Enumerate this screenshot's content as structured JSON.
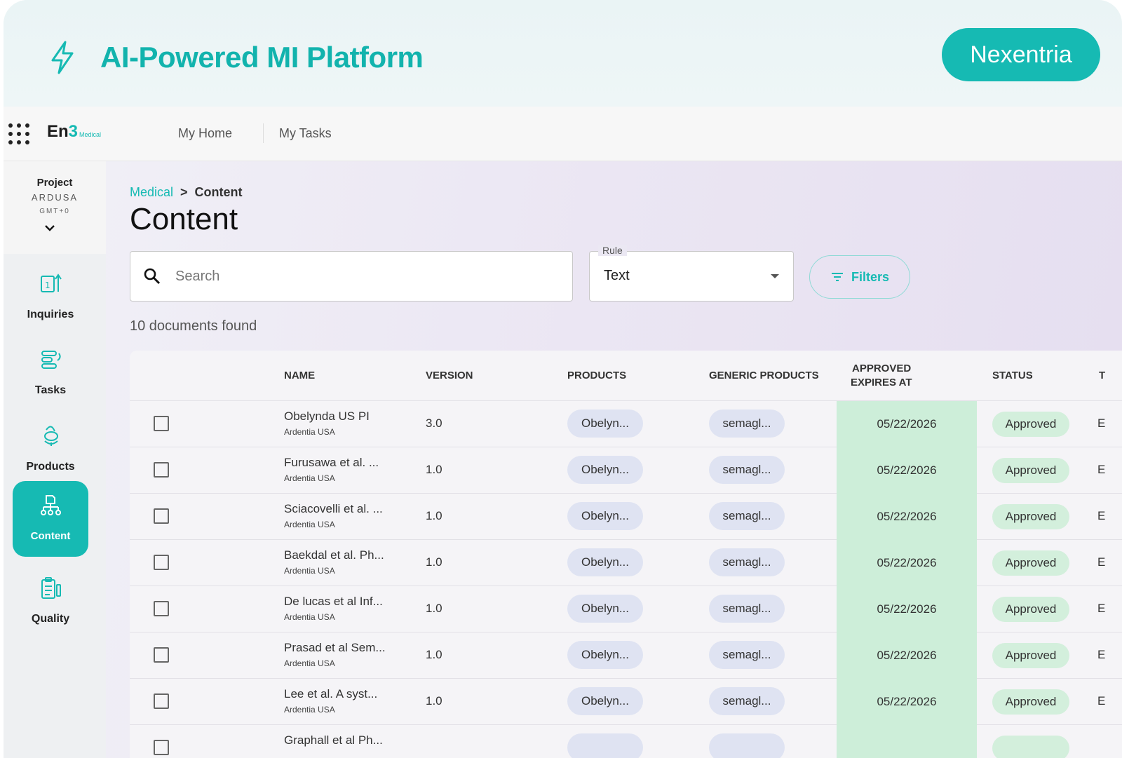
{
  "banner": {
    "title": "AI-Powered MI Platform",
    "brand_button": "Nexentria"
  },
  "topnav": {
    "logo": "En",
    "logo_three": "3",
    "logo_sub": "Medical",
    "items": [
      {
        "label": "My Home"
      },
      {
        "label": "My Tasks"
      }
    ]
  },
  "sidebar": {
    "project": {
      "label": "Project",
      "code": "ARDUSA",
      "timezone": "GMT+0"
    },
    "items": [
      {
        "label": "Inquiries",
        "icon": "inquiries-icon"
      },
      {
        "label": "Tasks",
        "icon": "tasks-icon"
      },
      {
        "label": "Products",
        "icon": "products-icon"
      },
      {
        "label": "Content",
        "icon": "content-icon",
        "active": true
      },
      {
        "label": "Quality",
        "icon": "quality-icon"
      }
    ]
  },
  "breadcrumb": {
    "root": "Medical",
    "current": "Content"
  },
  "page_title": "Content",
  "search": {
    "placeholder": "Search",
    "value": ""
  },
  "rule": {
    "label": "Rule",
    "value": "Text"
  },
  "filters_label": "Filters",
  "results_text": "10 documents found",
  "table": {
    "headers": {
      "name": "NAME",
      "version": "VERSION",
      "products": "PRODUCTS",
      "generic_products": "GENERIC PRODUCTS",
      "approved_line1": "APPROVED",
      "approved_line2": "EXPIRES AT",
      "status": "STATUS",
      "next": "T"
    },
    "rows": [
      {
        "name": "Obelynda US PI",
        "org": "Ardentia USA",
        "version": "3.0",
        "product": "Obelyn...",
        "generic": "semagl...",
        "expires": "05/22/2026",
        "status": "Approved",
        "next": "E"
      },
      {
        "name": "Furusawa et al. ...",
        "org": "Ardentia USA",
        "version": "1.0",
        "product": "Obelyn...",
        "generic": "semagl...",
        "expires": "05/22/2026",
        "status": "Approved",
        "next": "E"
      },
      {
        "name": "Sciacovelli et al. ...",
        "org": "Ardentia USA",
        "version": "1.0",
        "product": "Obelyn...",
        "generic": "semagl...",
        "expires": "05/22/2026",
        "status": "Approved",
        "next": "E"
      },
      {
        "name": "Baekdal et al. Ph...",
        "org": "Ardentia USA",
        "version": "1.0",
        "product": "Obelyn...",
        "generic": "semagl...",
        "expires": "05/22/2026",
        "status": "Approved",
        "next": "E"
      },
      {
        "name": "De lucas et al Inf...",
        "org": "Ardentia USA",
        "version": "1.0",
        "product": "Obelyn...",
        "generic": "semagl...",
        "expires": "05/22/2026",
        "status": "Approved",
        "next": "E"
      },
      {
        "name": "Prasad et al Sem...",
        "org": "Ardentia USA",
        "version": "1.0",
        "product": "Obelyn...",
        "generic": "semagl...",
        "expires": "05/22/2026",
        "status": "Approved",
        "next": "E"
      },
      {
        "name": "Lee et al. A syst...",
        "org": "Ardentia USA",
        "version": "1.0",
        "product": "Obelyn...",
        "generic": "semagl...",
        "expires": "05/22/2026",
        "status": "Approved",
        "next": "E"
      },
      {
        "name": "Graphall et al Ph...",
        "org": "",
        "version": "",
        "product": "",
        "generic": "",
        "expires": "",
        "status": "",
        "next": ""
      }
    ]
  },
  "colors": {
    "accent": "#16bab3",
    "approved_bg": "#cdeed9",
    "chip_bg": "#dfe3f2"
  }
}
